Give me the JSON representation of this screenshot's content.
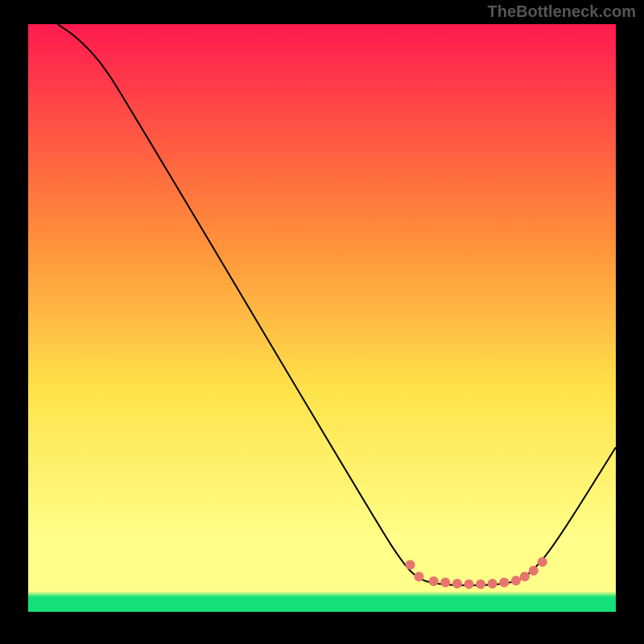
{
  "watermark": "TheBottleneck.com",
  "chart_data": {
    "type": "line",
    "xlim": [
      0,
      100
    ],
    "ylim": [
      0,
      100
    ],
    "xlabel": "",
    "ylabel": "",
    "title": "",
    "background_gradient": {
      "top": "#ff1a4f",
      "mid1": "#ff8a3a",
      "mid2": "#ffe24a",
      "mid3": "#ffff8a",
      "bottom": "#14e07a"
    },
    "series": [
      {
        "name": "curve",
        "color": "#000000",
        "stroke_width": 2,
        "points": [
          {
            "x": 5,
            "y": 100
          },
          {
            "x": 8,
            "y": 98
          },
          {
            "x": 12,
            "y": 94
          },
          {
            "x": 16,
            "y": 88
          },
          {
            "x": 60,
            "y": 14
          },
          {
            "x": 64,
            "y": 8
          },
          {
            "x": 66,
            "y": 6
          },
          {
            "x": 68,
            "y": 5
          },
          {
            "x": 72,
            "y": 4.5
          },
          {
            "x": 78,
            "y": 4.5
          },
          {
            "x": 83,
            "y": 5
          },
          {
            "x": 86,
            "y": 7
          },
          {
            "x": 90,
            "y": 12
          },
          {
            "x": 100,
            "y": 28
          }
        ]
      }
    ],
    "markers": {
      "color": "#e8756d",
      "radius": 6,
      "points": [
        {
          "x": 65,
          "y": 8
        },
        {
          "x": 66.5,
          "y": 6
        },
        {
          "x": 69,
          "y": 5.2
        },
        {
          "x": 71,
          "y": 5
        },
        {
          "x": 73,
          "y": 4.8
        },
        {
          "x": 75,
          "y": 4.7
        },
        {
          "x": 77,
          "y": 4.7
        },
        {
          "x": 79,
          "y": 4.8
        },
        {
          "x": 81,
          "y": 5
        },
        {
          "x": 83,
          "y": 5.3
        },
        {
          "x": 84.5,
          "y": 6
        },
        {
          "x": 86,
          "y": 7
        },
        {
          "x": 87.5,
          "y": 8.5
        }
      ]
    }
  }
}
